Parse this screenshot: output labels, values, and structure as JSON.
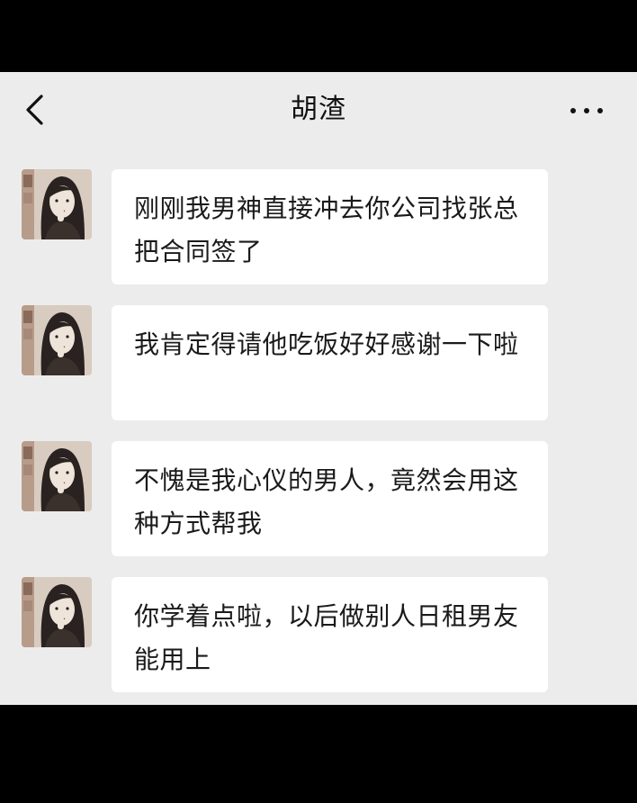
{
  "header": {
    "title": "胡渣",
    "back_icon": "chevron-left-icon",
    "more_icon": "more-horizontal-icon"
  },
  "messages": [
    {
      "sender": "contact",
      "avatar": "woman-avatar",
      "text": "刚刚我男神直接冲去你公司找张总把合同签了"
    },
    {
      "sender": "contact",
      "avatar": "woman-avatar",
      "text": "我肯定得请他吃饭好好感谢一下啦"
    },
    {
      "sender": "contact",
      "avatar": "woman-avatar",
      "text": "不愧是我心仪的男人，竟然会用这种方式帮我"
    },
    {
      "sender": "contact",
      "avatar": "woman-avatar",
      "text": "你学着点啦，以后做别人日租男友能用上"
    }
  ],
  "colors": {
    "chat_background": "#ececec",
    "bubble": "#ffffff",
    "letterbox": "#000000",
    "text": "#1a1a1a"
  }
}
